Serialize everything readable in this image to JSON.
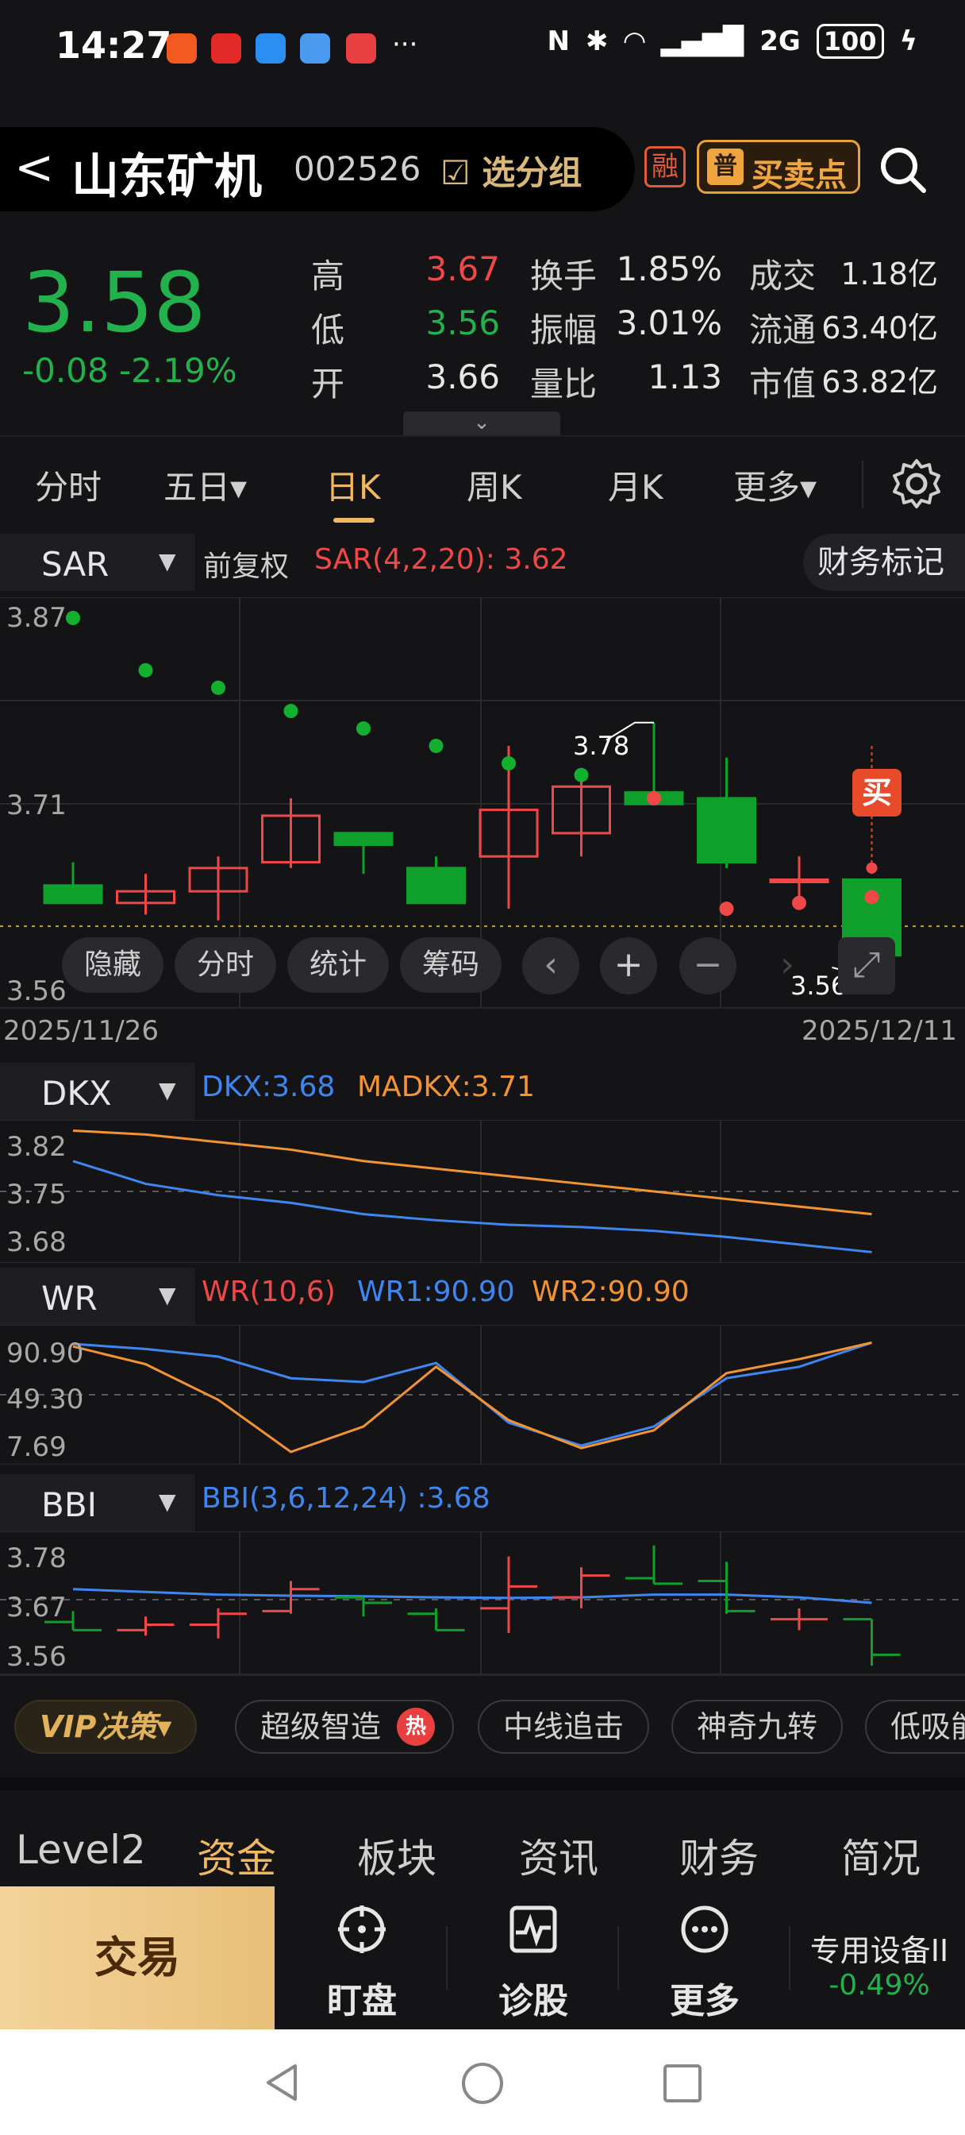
{
  "status": {
    "time": "14:27",
    "dots": "···",
    "signal": "2G",
    "battery": "100"
  },
  "header": {
    "back": "<",
    "name": "山东矿机",
    "code": "002526",
    "group": "选分组",
    "rong": "融",
    "pu": "普",
    "buysell": "买卖点"
  },
  "quote": {
    "price": "3.58",
    "change": "-0.08",
    "pct": "-2.19%",
    "rows": [
      {
        "l1": "高",
        "v1": "3.67",
        "l2": "换手",
        "v2": "1.85%",
        "l3": "成交",
        "v3": "1.18亿"
      },
      {
        "l1": "低",
        "v1": "3.56",
        "l2": "振幅",
        "v2": "3.01%",
        "l3": "流通",
        "v3": "63.40亿"
      },
      {
        "l1": "开",
        "v1": "3.66",
        "l2": "量比",
        "v2": "1.13",
        "l3": "市值",
        "v3": "63.82亿"
      }
    ],
    "handle": "⌄"
  },
  "tabs": [
    "分时",
    "五日▾",
    "日K",
    "周K",
    "月K",
    "更多▾"
  ],
  "sar": {
    "name": "SAR",
    "adj": "前复权",
    "label": "SAR(4,2,20):",
    "value": "3.62",
    "finance": "财务标记",
    "y_top": "3.87",
    "y_mid": "3.71",
    "y_bot": "3.56",
    "hi_label": "3.78",
    "lo_label": "3.56",
    "buy": "买"
  },
  "tools": [
    "隐藏",
    "分时",
    "统计",
    "筹码"
  ],
  "dates": {
    "start": "2025/11/26",
    "end": "2025/12/11"
  },
  "dkx": {
    "name": "DKX",
    "dkx": "DKX:3.68",
    "madkx": "MADKX:3.71",
    "y": [
      "3.82",
      "3.75",
      "3.68"
    ]
  },
  "wr": {
    "name": "WR",
    "params": "WR(10,6)",
    "wr1": "WR1:90.90",
    "wr2": "WR2:90.90",
    "y": [
      "90.90",
      "49.30",
      "7.69"
    ]
  },
  "bbi": {
    "name": "BBI",
    "params": "BBI(3,6,12,24)",
    "val": ":3.68",
    "y": [
      "3.78",
      "3.67",
      "3.56"
    ]
  },
  "strategies": {
    "vip": "VIP决策▾",
    "items": [
      "超级智造",
      "中线追击",
      "神奇九转",
      "低吸能"
    ],
    "hot": "热"
  },
  "bottom_tabs": [
    "Level2",
    "资金",
    "板块",
    "资讯",
    "财务",
    "简况"
  ],
  "actions": {
    "trade": "交易",
    "watch": "盯盘",
    "diagnose": "诊股",
    "more": "更多",
    "sector": "专用设备II",
    "sector_pct": "-0.49%"
  },
  "chart_data": {
    "type": "candlestick",
    "dates": [
      "2025/11/26",
      "",
      "",
      "",
      "",
      "",
      "",
      "",
      "",
      "",
      "",
      "2025/12/11"
    ],
    "ylim": [
      3.56,
      3.87
    ],
    "candles": [
      {
        "o": 3.64,
        "c": 3.625,
        "h": 3.66,
        "l": 3.625
      },
      {
        "o": 3.625,
        "c": 3.635,
        "h": 3.65,
        "l": 3.615
      },
      {
        "o": 3.635,
        "c": 3.655,
        "h": 3.665,
        "l": 3.61
      },
      {
        "o": 3.66,
        "c": 3.7,
        "h": 3.715,
        "l": 3.655
      },
      {
        "o": 3.685,
        "c": 3.675,
        "h": 3.685,
        "l": 3.65
      },
      {
        "o": 3.655,
        "c": 3.625,
        "h": 3.665,
        "l": 3.625
      },
      {
        "o": 3.665,
        "c": 3.705,
        "h": 3.76,
        "l": 3.62
      },
      {
        "o": 3.685,
        "c": 3.725,
        "h": 3.74,
        "l": 3.665
      },
      {
        "o": 3.72,
        "c": 3.71,
        "h": 3.78,
        "l": 3.71
      },
      {
        "o": 3.715,
        "c": 3.66,
        "h": 3.75,
        "l": 3.655
      },
      {
        "o": 3.645,
        "c": 3.645,
        "h": 3.665,
        "l": 3.625
      },
      {
        "o": 3.645,
        "c": 3.58,
        "h": 3.645,
        "l": 3.56
      }
    ],
    "sar": [
      3.87,
      3.825,
      3.81,
      3.79,
      3.775,
      3.76,
      3.745,
      3.735,
      3.715,
      3.62,
      3.625,
      3.63
    ],
    "sar_color": [
      "up",
      "up",
      "up",
      "up",
      "up",
      "up",
      "up",
      "up",
      "dn",
      "dn",
      "dn",
      "dn"
    ],
    "dkx": {
      "ylim": [
        3.66,
        3.84
      ],
      "dkx": [
        3.79,
        3.76,
        3.745,
        3.735,
        3.72,
        3.712,
        3.706,
        3.703,
        3.698,
        3.69,
        3.68,
        3.67
      ],
      "madkx": [
        3.83,
        3.825,
        3.815,
        3.805,
        3.79,
        3.78,
        3.77,
        3.76,
        3.75,
        3.74,
        3.73,
        3.72
      ]
    },
    "wr": {
      "ylim": [
        0,
        100
      ],
      "wr1": [
        90,
        86,
        80,
        63,
        60,
        75,
        28,
        10,
        25,
        63,
        72,
        91
      ],
      "wr2": [
        88,
        74,
        46,
        5,
        25,
        72,
        30,
        8,
        22,
        67,
        78,
        91
      ]
    },
    "bbi": {
      "ylim": [
        3.55,
        3.8
      ],
      "bbi": [
        3.7,
        3.695,
        3.69,
        3.688,
        3.687,
        3.685,
        3.684,
        3.685,
        3.69,
        3.69,
        3.685,
        3.675
      ]
    }
  }
}
